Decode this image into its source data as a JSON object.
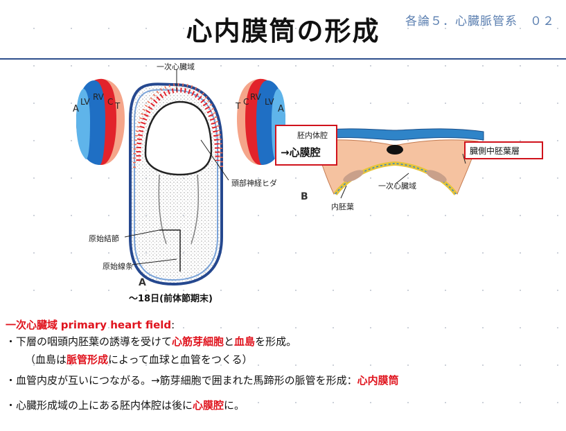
{
  "header": {
    "title": "心内膜筒の形成",
    "course_label": "各論５．心臓脈管系　０２"
  },
  "figure": {
    "fig_a": {
      "letter": "A",
      "caption": "～18日(前体節期末)",
      "label_primary_field": "一次心臓域",
      "label_head_fold": "頭部神経ヒダ",
      "label_node": "原始結節",
      "label_streak": "原始線条",
      "left_heart_labels": [
        "A",
        "LV",
        "RV",
        "C",
        "T"
      ],
      "right_heart_labels": [
        "T",
        "C",
        "RV",
        "LV",
        "A"
      ]
    },
    "fig_b": {
      "letter": "B",
      "label_coelom": "胚内体腔",
      "label_pericardial": "→心膜腔",
      "label_lateral_mesoderm": "臓側中胚葉層",
      "label_primary_field": "一次心臓域",
      "label_endoderm": "内胚葉"
    },
    "colors": {
      "heart_blue": "#1f6fc4",
      "heart_light_blue": "#5fb4ea",
      "heart_red": "#e2232b",
      "heart_salmon": "#f5a58a",
      "highlight_red": "#d0121b"
    }
  },
  "body": {
    "heading_term": "一次心臓域",
    "heading_en": "primary heart field",
    "heading_colon": ":",
    "bullet1_a": "・下層の咽頭内胚葉の誘導を受けて",
    "bullet1_b": "心筋芽細胞",
    "bullet1_c": "と",
    "bullet1_d": "血島",
    "bullet1_e": "を形成。",
    "bullet1_sub_a": "（血島は",
    "bullet1_sub_b": "脈管形成",
    "bullet1_sub_c": "によって血球と血管をつくる）",
    "bullet2_a": "・血管内皮が互いにつながる。→筋芽細胞で囲まれた馬蹄形の脈管を形成：",
    "bullet2_b": "心内膜筒",
    "bullet3_a": "・心臓形成域の上にある胚内体腔は後に",
    "bullet3_b": "心膜腔",
    "bullet3_c": "に。"
  }
}
